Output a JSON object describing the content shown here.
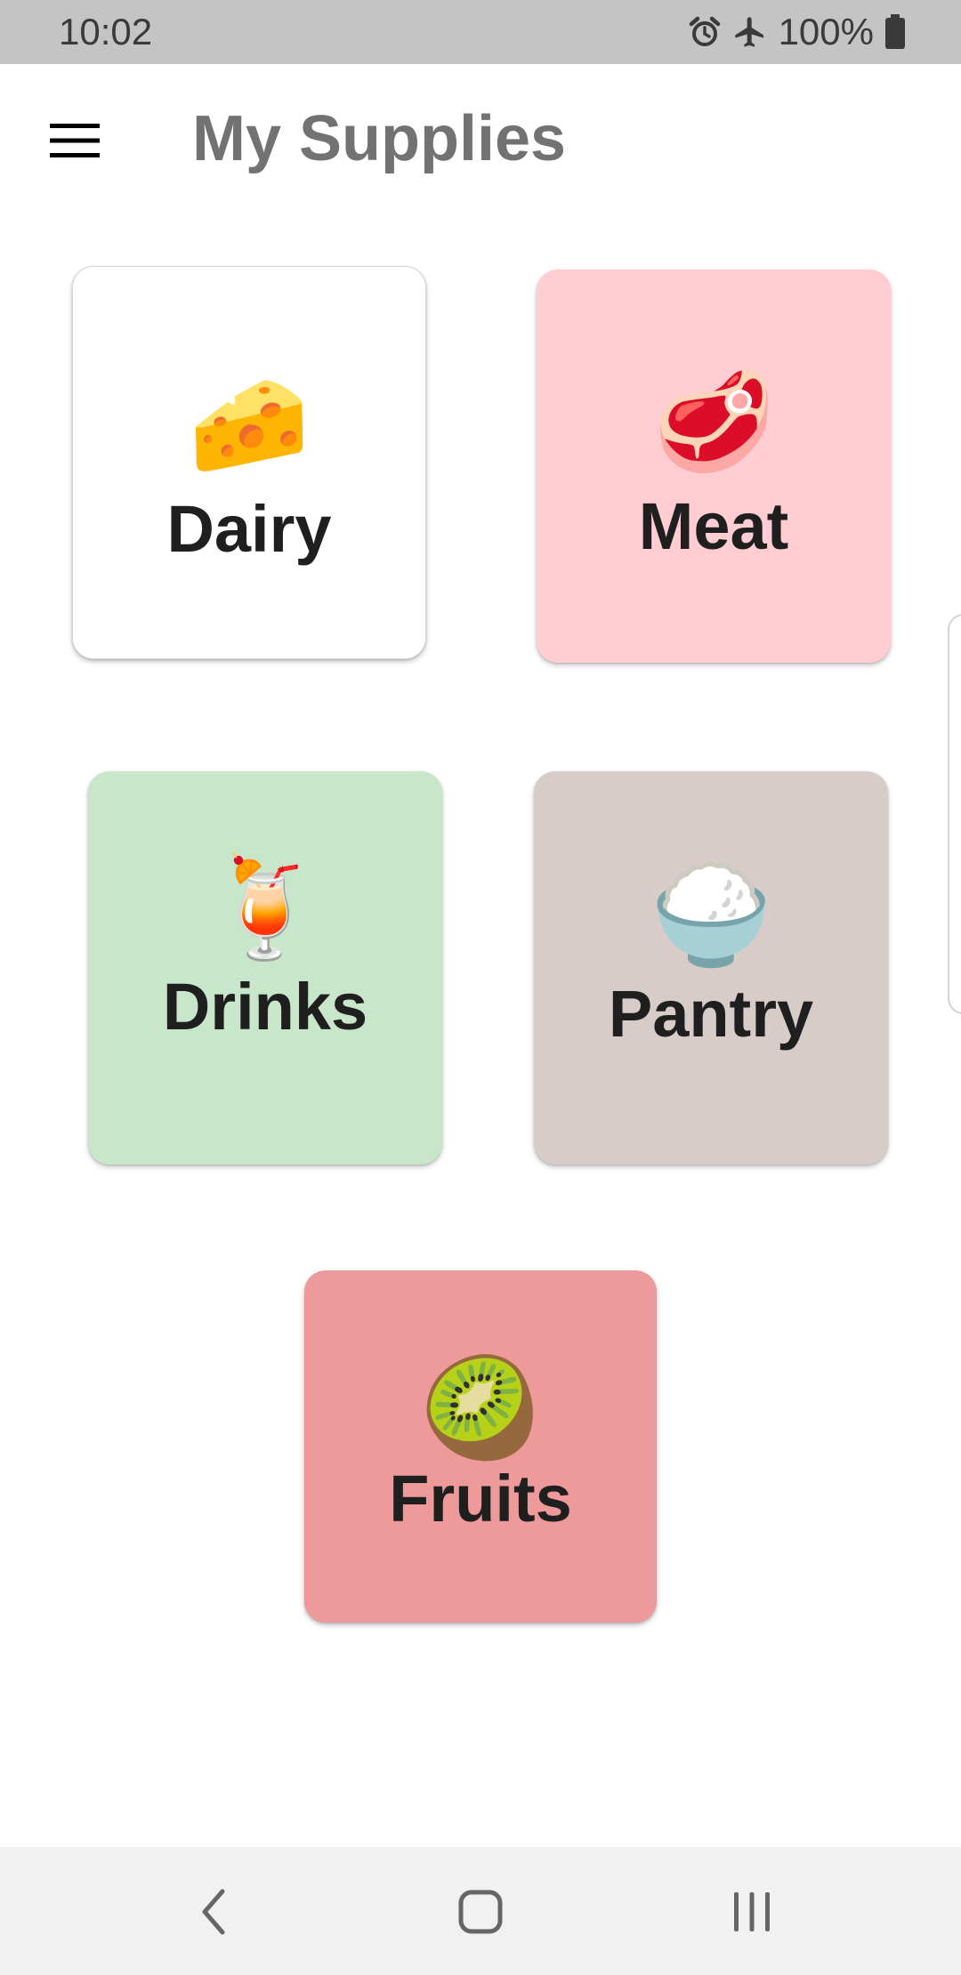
{
  "status_bar": {
    "time": "10:02",
    "battery_text": "100%",
    "icons": [
      "alarm-icon",
      "airplane-icon",
      "battery-icon"
    ]
  },
  "app_bar": {
    "title": "My Supplies",
    "menu_icon": "hamburger-menu-icon"
  },
  "categories": [
    {
      "label": "Dairy",
      "emoji": "🧀",
      "color": "#ffffff"
    },
    {
      "label": "Meat",
      "emoji": "🥩",
      "color": "#ffcdd2"
    },
    {
      "label": "Drinks",
      "emoji": "🍹",
      "color": "#c8e6c9"
    },
    {
      "label": "Pantry",
      "emoji": "🍚",
      "color": "#d7ccc8"
    },
    {
      "label": "Fruits",
      "emoji": "🥝",
      "color": "#ef9a9a"
    }
  ],
  "nav_bar": {
    "icons": [
      "back-icon",
      "home-icon",
      "recents-icon"
    ]
  }
}
